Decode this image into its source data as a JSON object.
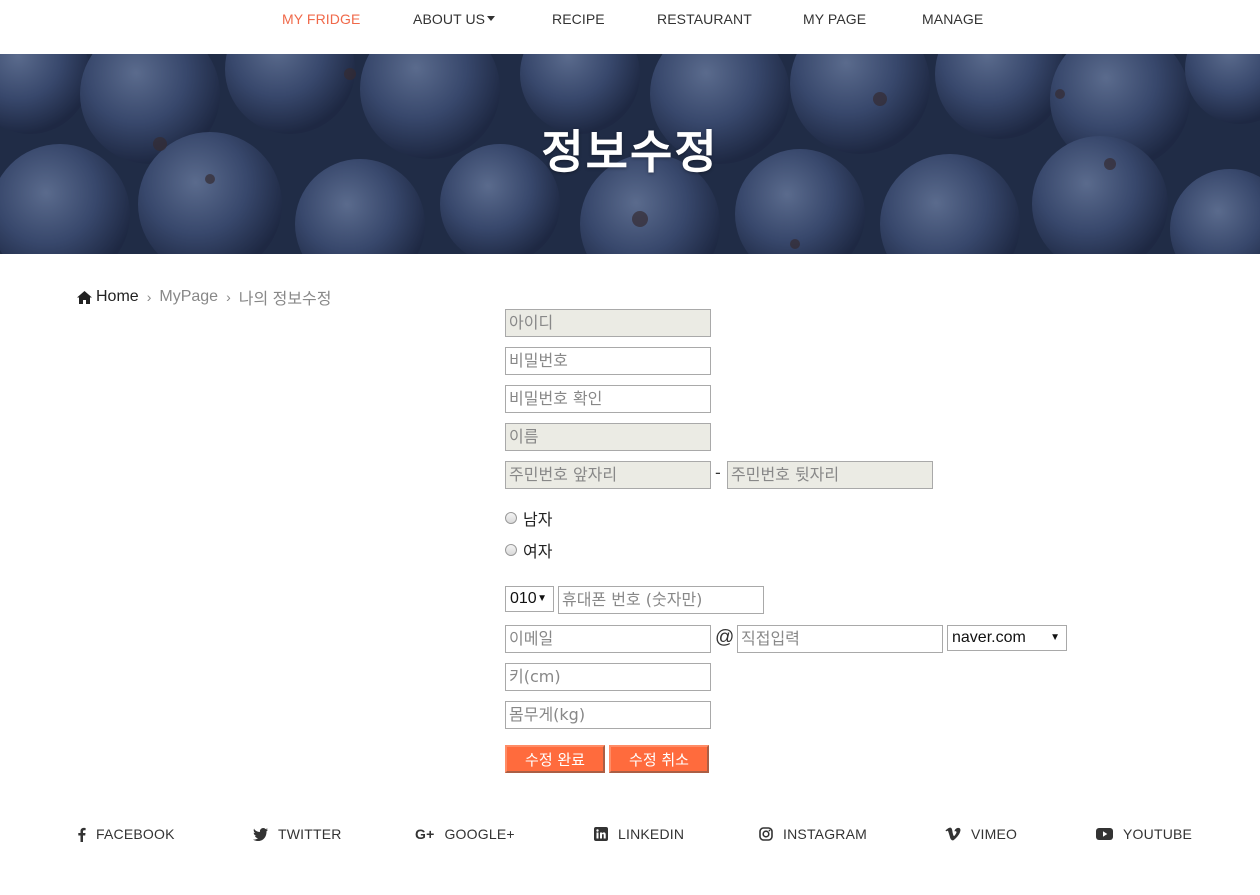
{
  "nav": {
    "items": [
      {
        "label": "MY FRIDGE",
        "active": true
      },
      {
        "label": "ABOUT US",
        "dropdown": true
      },
      {
        "label": "RECIPE"
      },
      {
        "label": "RESTAURANT"
      },
      {
        "label": "MY PAGE"
      },
      {
        "label": "MANAGE"
      }
    ]
  },
  "hero": {
    "title": "정보수정"
  },
  "breadcrumb": {
    "home": "Home",
    "items": [
      "MyPage",
      "나의 정보수정"
    ]
  },
  "form": {
    "id_placeholder": "아이디",
    "password_placeholder": "비밀번호",
    "password_confirm_placeholder": "비밀번호 확인",
    "name_placeholder": "이름",
    "ssn_front_placeholder": "주민번호 앞자리",
    "ssn_dash": "-",
    "ssn_back_placeholder": "주민번호 뒷자리",
    "gender_options": [
      "남자",
      "여자"
    ],
    "phone_prefix": "010",
    "phone_placeholder": "휴대폰 번호 (숫자만)",
    "email_placeholder": "이메일",
    "email_at": "@",
    "email_domain_placeholder": "직접입력",
    "email_domain_selected": "naver.com",
    "height_placeholder": "키(cm)",
    "weight_placeholder": "몸무게(kg)",
    "submit_label": "수정 완료",
    "cancel_label": "수정 취소"
  },
  "footer": {
    "social": [
      {
        "label": "FACEBOOK",
        "icon": "facebook-icon"
      },
      {
        "label": "TWITTER",
        "icon": "twitter-icon"
      },
      {
        "label": "GOOGLE+",
        "icon": "google-plus-icon"
      },
      {
        "label": "LINKEDIN",
        "icon": "linkedin-icon"
      },
      {
        "label": "INSTAGRAM",
        "icon": "instagram-icon"
      },
      {
        "label": "VIMEO",
        "icon": "vimeo-icon"
      },
      {
        "label": "YOUTUBE",
        "icon": "youtube-icon"
      }
    ]
  },
  "colors": {
    "accent": "#f0694a",
    "button": "#ff6b3d",
    "hero_bg": "#2b3a57",
    "readonly_bg": "#ebebe4"
  }
}
